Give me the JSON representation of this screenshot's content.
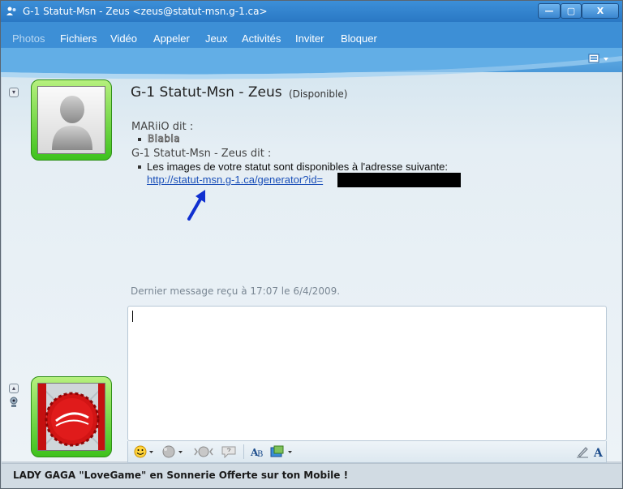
{
  "window": {
    "title": "G-1 Statut-Msn - Zeus <zeus@statut-msn.g-1.ca>",
    "controls": {
      "minimize": "—",
      "maximize": "▢",
      "close": "X"
    }
  },
  "menu": {
    "items": [
      {
        "label": "Photos",
        "enabled": false
      },
      {
        "label": "Fichiers",
        "enabled": true
      },
      {
        "label": "Vidéo",
        "enabled": true
      },
      {
        "label": "Appeler",
        "enabled": true
      },
      {
        "label": "Jeux",
        "enabled": true
      },
      {
        "label": "Activités",
        "enabled": true
      },
      {
        "label": "Inviter",
        "enabled": true
      },
      {
        "label": "Bloquer",
        "enabled": true
      }
    ],
    "right_icon": "toolbar-options-icon"
  },
  "header": {
    "contact_name": "G-1 Statut-Msn - Zeus",
    "contact_status": "(Disponible)"
  },
  "conversation": {
    "messages": [
      {
        "sender": "MARiiO dit :",
        "text": "Blabla"
      },
      {
        "sender": "G-1 Statut-Msn - Zeus dit :",
        "text": "Les images de votre statut sont disponibles à l'adresse suivante:",
        "link": "http://statut-msn.g-1.ca/generator?id="
      }
    ],
    "last_message": "Dernier message reçu à 17:07 le 6/4/2009."
  },
  "input": {
    "value": ""
  },
  "ad": {
    "text": "LADY GAGA \"LoveGame\" en Sonnerie Offerte sur ton Mobile !"
  },
  "colors": {
    "titlebar": "#2a78c4",
    "menubar": "#4a98d8",
    "avatar_frame": "#3ec21d",
    "link": "#1a4fb8",
    "arrow": "#1030d0"
  },
  "icons": {
    "emoticon": "emoticon-icon",
    "wink": "wink-icon",
    "nudge": "nudge-icon",
    "voice_clip": "voice-clip-icon",
    "font": "font-icon",
    "background": "background-icon",
    "handwriting": "handwriting-icon",
    "text_format": "text-format-icon"
  }
}
